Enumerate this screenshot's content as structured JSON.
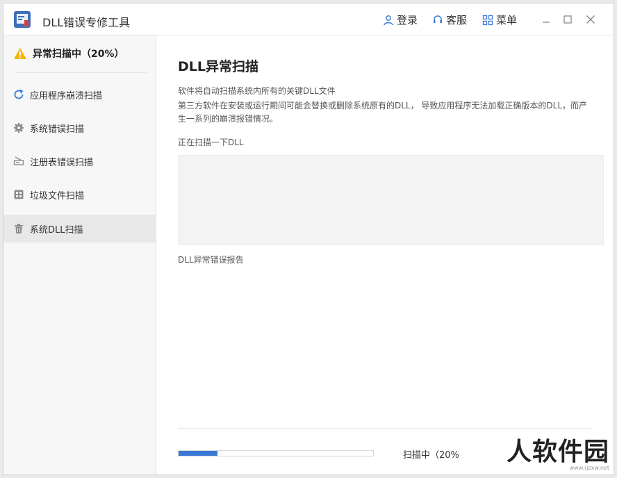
{
  "titlebar": {
    "app_title": "DLL错误专修工具",
    "login_label": "登录",
    "support_label": "客服",
    "menu_label": "菜单"
  },
  "sidebar": {
    "scan_status": "异常扫描中（20%）",
    "items": [
      {
        "label": "应用程序崩溃扫描",
        "icon": "refresh-icon"
      },
      {
        "label": "系统错误扫描",
        "icon": "gear-icon"
      },
      {
        "label": "注册表错误扫描",
        "icon": "registry-icon"
      },
      {
        "label": "垃圾文件扫描",
        "icon": "grid-icon"
      },
      {
        "label": "系统DLL扫描",
        "icon": "trash-icon",
        "active": true
      }
    ]
  },
  "main": {
    "heading": "DLL异常扫描",
    "desc1": "软件将自动扫描系统内所有的关键DLL文件",
    "desc2": "第三方软件在安装或运行期间可能会替换或删除系统原有的DLL， 导致应用程序无法加载正确版本的DLL，而产生一系列的崩溃报错情况。",
    "scanning_label": "正在扫描一下DLL",
    "report_label": "DLL异常错误报告",
    "progress_percent": 20,
    "progress_text": "扫描中（20%）"
  },
  "watermark": {
    "text": "人软件园",
    "url": "www.rjzxw.net"
  },
  "colors": {
    "accent": "#3a78d6",
    "warning": "#f5b400"
  }
}
